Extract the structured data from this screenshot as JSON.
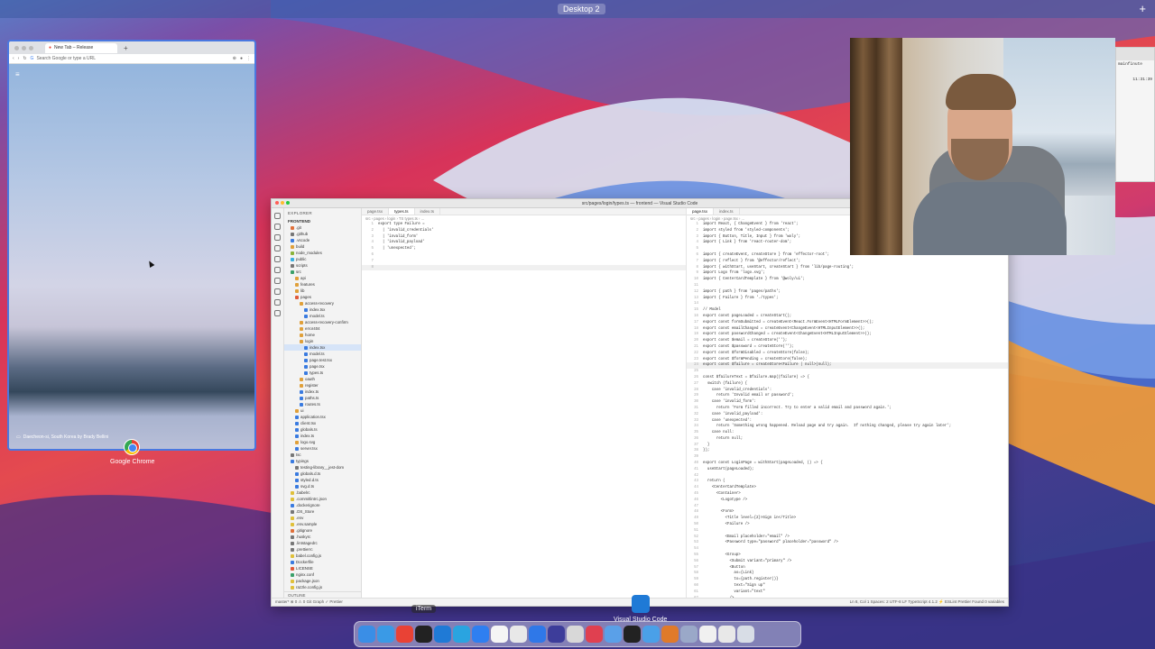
{
  "desktop": {
    "space_label": "Desktop 2",
    "add_space": "+"
  },
  "chrome": {
    "tab_title": "New Tab – Release",
    "new_tab": "+",
    "omnibox_placeholder": "Search Google or type a URL",
    "caption": "Daecheon-si, South Korea by Brady Bellini",
    "app_label": "Google Chrome"
  },
  "vscode": {
    "window_title": "src/pages/login/types.ts — frontend — Visual Studio Code",
    "explorer_header": "EXPLORER",
    "project": "FRONTEND",
    "outline": "OUTLINE",
    "tree": [
      {
        "label": ".git",
        "indent": 1,
        "color": "#e0703a"
      },
      {
        "label": ".github",
        "indent": 1,
        "color": "#777"
      },
      {
        "label": ".vscode",
        "indent": 1,
        "color": "#3a7be0"
      },
      {
        "label": "build",
        "indent": 1,
        "color": "#e0a03a"
      },
      {
        "label": "node_modules",
        "indent": 1,
        "color": "#8bb33a"
      },
      {
        "label": "public",
        "indent": 1,
        "color": "#3ab0e0"
      },
      {
        "label": "scripts",
        "indent": 1,
        "color": "#777"
      },
      {
        "label": "src",
        "indent": 1,
        "color": "#3aa06a"
      },
      {
        "label": "api",
        "indent": 2,
        "color": "#e0a03a"
      },
      {
        "label": "features",
        "indent": 2,
        "color": "#e0a03a"
      },
      {
        "label": "lib",
        "indent": 2,
        "color": "#e0a03a"
      },
      {
        "label": "pages",
        "indent": 2,
        "color": "#e05a3a"
      },
      {
        "label": "access-recovery",
        "indent": 3,
        "color": "#e0a03a"
      },
      {
        "label": "index.tsx",
        "indent": 4,
        "color": "#3a7be0"
      },
      {
        "label": "model.ts",
        "indent": 4,
        "color": "#3a7be0"
      },
      {
        "label": "access-recovery-confirm",
        "indent": 3,
        "color": "#e0a03a"
      },
      {
        "label": "error404",
        "indent": 3,
        "color": "#e0a03a"
      },
      {
        "label": "home",
        "indent": 3,
        "color": "#e0a03a"
      },
      {
        "label": "login",
        "indent": 3,
        "color": "#e0a03a"
      },
      {
        "label": "index.tsx",
        "indent": 4,
        "color": "#3a7be0",
        "selected": true
      },
      {
        "label": "model.ts",
        "indent": 4,
        "color": "#3a7be0"
      },
      {
        "label": "page.test.tsx",
        "indent": 4,
        "color": "#3a7be0"
      },
      {
        "label": "page.tsx",
        "indent": 4,
        "color": "#3a7be0"
      },
      {
        "label": "types.ts",
        "indent": 4,
        "color": "#3a7be0"
      },
      {
        "label": "oauth",
        "indent": 3,
        "color": "#e0a03a"
      },
      {
        "label": "register",
        "indent": 3,
        "color": "#e0a03a"
      },
      {
        "label": "index.ts",
        "indent": 3,
        "color": "#3a7be0"
      },
      {
        "label": "paths.ts",
        "indent": 3,
        "color": "#3a7be0"
      },
      {
        "label": "routes.ts",
        "indent": 3,
        "color": "#3a7be0"
      },
      {
        "label": "ui",
        "indent": 2,
        "color": "#e0a03a"
      },
      {
        "label": "application.tsx",
        "indent": 2,
        "color": "#3a7be0"
      },
      {
        "label": "client.tsx",
        "indent": 2,
        "color": "#3a7be0"
      },
      {
        "label": "globals.ts",
        "indent": 2,
        "color": "#3a7be0"
      },
      {
        "label": "index.ts",
        "indent": 2,
        "color": "#3a7be0"
      },
      {
        "label": "logo.svg",
        "indent": 2,
        "color": "#e0a03a"
      },
      {
        "label": "server.tsx",
        "indent": 2,
        "color": "#3a7be0"
      },
      {
        "label": "tsc",
        "indent": 1,
        "color": "#777"
      },
      {
        "label": "typings",
        "indent": 1,
        "color": "#3a7be0"
      },
      {
        "label": "testing-library__jest-dom",
        "indent": 2,
        "color": "#777"
      },
      {
        "label": "globals.d.ts",
        "indent": 2,
        "color": "#3a7be0"
      },
      {
        "label": "styled.d.ts",
        "indent": 2,
        "color": "#3a7be0"
      },
      {
        "label": "svg.d.ts",
        "indent": 2,
        "color": "#3a7be0"
      },
      {
        "label": ".babelrc",
        "indent": 1,
        "color": "#e0c03a"
      },
      {
        "label": ".commitlintrc.json",
        "indent": 1,
        "color": "#e0c03a"
      },
      {
        "label": ".dockerignore",
        "indent": 1,
        "color": "#3a7be0"
      },
      {
        "label": ".DS_Store",
        "indent": 1,
        "color": "#777"
      },
      {
        "label": ".env",
        "indent": 1,
        "color": "#e0c03a"
      },
      {
        "label": ".env.sample",
        "indent": 1,
        "color": "#e0c03a"
      },
      {
        "label": ".gitignore",
        "indent": 1,
        "color": "#e0703a"
      },
      {
        "label": ".huskyrc",
        "indent": 1,
        "color": "#777"
      },
      {
        "label": ".lintstagedrc",
        "indent": 1,
        "color": "#777"
      },
      {
        "label": ".prettierrc",
        "indent": 1,
        "color": "#777"
      },
      {
        "label": "babel.config.js",
        "indent": 1,
        "color": "#e0c03a"
      },
      {
        "label": "Dockerfile",
        "indent": 1,
        "color": "#3a7be0"
      },
      {
        "label": "LICENSE",
        "indent": 1,
        "color": "#e05a3a"
      },
      {
        "label": "nginx.conf",
        "indent": 1,
        "color": "#3aa06a"
      },
      {
        "label": "package.json",
        "indent": 1,
        "color": "#e0c03a"
      },
      {
        "label": "razzle.config.js",
        "indent": 1,
        "color": "#e0c03a"
      }
    ],
    "left_tabs": [
      "page.tsx",
      "types.ts",
      "index.ts"
    ],
    "left_active": 1,
    "left_crumb": "src › pages › login › TS types.ts › ...",
    "left_code": [
      "export type Failure =",
      "  | 'invalid_credentials'",
      "  | 'invalid_form'",
      "  | 'invalid_payload'",
      "  | 'unexpected';",
      "",
      "",
      ""
    ],
    "right_tabs": [
      "page.tsx",
      "index.ts"
    ],
    "right_active": 0,
    "right_crumb": "src › pages › login › page.tsx › ...",
    "right_code": [
      "import React, { ChangeEvent } from 'react';",
      "import styled from 'styled-components';",
      "import { Button, Title, Input } from 'woly';",
      "import { Link } from 'react-router-dom';",
      "",
      "import { createEvent, createStore } from 'effector-root';",
      "import { reflect } from '@effector/reflect';",
      "import { withStart, useStart, createStart } from 'lib/page-routing';",
      "import Logo from 'logo.svg';",
      "import { CenterCardTemplate } from '@woly/ui';",
      "",
      "import { path } from 'pages/paths';",
      "import { Failure } from './types';",
      "",
      "// Model",
      "export const pageLoaded = createStart();",
      "export const formSubmitted = createEvent<React.FormEvent<HTMLFormElement>>();",
      "export const emailChanged = createEvent<ChangeEvent<HTMLInputElement>>();",
      "export const passwordChanged = createEvent<ChangeEvent<HTMLInputElement>>();",
      "export const $email = createStore('');",
      "export const $password = createStore('');",
      "export const $formDisabled = createStore(false);",
      "export const $formPending = createStore(false);",
      "export const $failure = createStore<Failure | null>(null);",
      "",
      "const $failureText = $failure.map((failure) => {",
      "  switch (failure) {",
      "    case 'invalid_credentials':",
      "      return 'Invalid email or password';",
      "    case 'invalid_form':",
      "      return 'Form filled incorrect. Try to enter a valid email and password again.';",
      "    case 'invalid_payload':",
      "    case 'unexpected':",
      "      return 'Something wrong happened. Reload page and try again.  If nothing changed, please try again later';",
      "    case null:",
      "      return null;",
      "  }",
      "});",
      "",
      "export const LoginPage = withStart(pageLoaded, () => {",
      "  useStart(pageLoaded);",
      "",
      "  return (",
      "    <CenterCardTemplate>",
      "      <Container>",
      "        <Logotype />",
      "",
      "        <Form>",
      "          <Title level={2}>Sign in</Title>",
      "          <Failure />",
      "",
      "          <Email placeholder=\"email\" />",
      "          <Password type=\"password\" placeholder=\"password\" />",
      "",
      "          <Group>",
      "            <Submit variant=\"primary\" />",
      "            <Button",
      "              as={Link}",
      "              to={path.register()}",
      "              text=\"Sign up\"",
      "              variant=\"text\"",
      "            />",
      "          </Group>"
    ],
    "status_left": "master*   ⊗ 0 ⚠ 0   Git Graph   ✓ Prettier",
    "status_right": "Ln 8, Col 1   Spaces: 2   UTF-8   LF   TypeScript   4.1.2   ⚡ ESLint   Prettier   Found 0 variables"
  },
  "iterm_bg": {
    "line1": "mainfinute",
    "line2": "11:31:39"
  },
  "dock": {
    "iterm_tooltip": "iTerm",
    "vscode_label": "Visual Studio Code",
    "icons": [
      {
        "name": "finder-icon",
        "color": "#3a8ee6"
      },
      {
        "name": "safari-icon",
        "color": "#3a9ae6"
      },
      {
        "name": "chrome-icon",
        "color": "#e94235"
      },
      {
        "name": "iterm-icon",
        "color": "#222222"
      },
      {
        "name": "vscode-icon",
        "color": "#1f7ad6"
      },
      {
        "name": "telegram-icon",
        "color": "#2aa4e0"
      },
      {
        "name": "appstore-icon",
        "color": "#2f7ff0"
      },
      {
        "name": "calendar-icon",
        "color": "#f5f5f5"
      },
      {
        "name": "slack-icon",
        "color": "#e8e8e8"
      },
      {
        "name": "cloud-icon",
        "color": "#2f78e8"
      },
      {
        "name": "vpn-icon",
        "color": "#3d3d9a"
      },
      {
        "name": "reminders-icon",
        "color": "#d8d8d8"
      },
      {
        "name": "tasks-icon",
        "color": "#e04050"
      },
      {
        "name": "preview-icon",
        "color": "#5aa0e8"
      },
      {
        "name": "github-icon",
        "color": "#222222"
      },
      {
        "name": "folder-icon",
        "color": "#4aa0e8"
      },
      {
        "name": "transmit-icon",
        "color": "#e07a2a"
      },
      {
        "name": "downloads-icon",
        "color": "#9aa8c8"
      },
      {
        "name": "stack-icon",
        "color": "#f0f0f0"
      },
      {
        "name": "stack2-icon",
        "color": "#e8e8e8"
      },
      {
        "name": "trash-icon",
        "color": "#d8dde6"
      }
    ]
  }
}
